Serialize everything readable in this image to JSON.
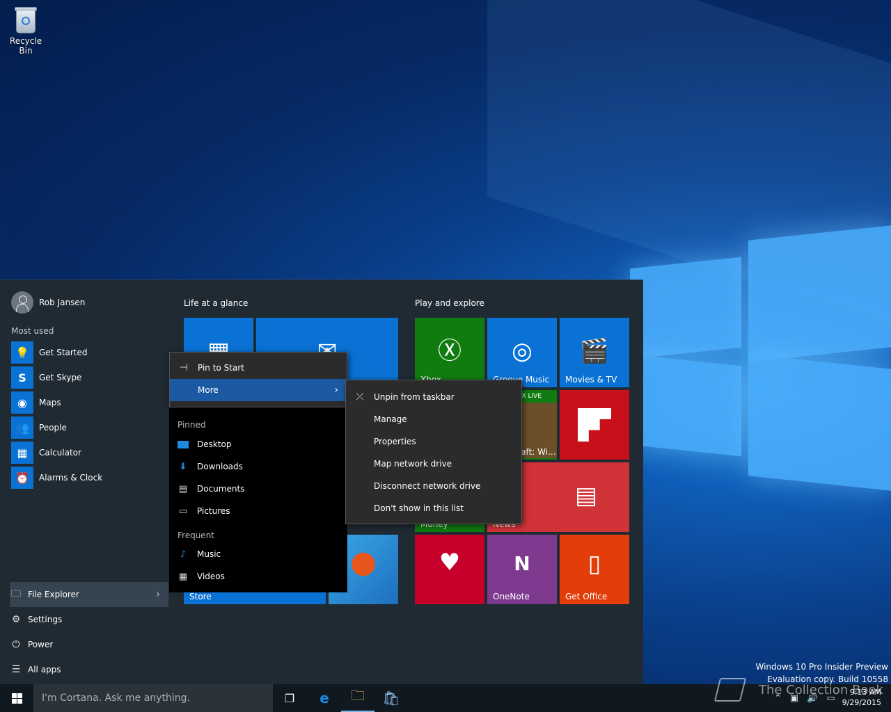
{
  "desktop": {
    "recycle_bin_label": "Recycle Bin",
    "watermark_line1": "Windows 10 Pro Insider Preview",
    "watermark_line2": "Evaluation copy. Build 10558",
    "brand_text": "The Collection Book"
  },
  "start": {
    "user_name": "Rob Jansen",
    "most_used_header": "Most used",
    "most_used": [
      {
        "label": "Get Started",
        "icon": "lightbulb-icon"
      },
      {
        "label": "Get Skype",
        "icon": "skype-icon"
      },
      {
        "label": "Maps",
        "icon": "maps-icon"
      },
      {
        "label": "People",
        "icon": "people-icon"
      },
      {
        "label": "Calculator",
        "icon": "calculator-icon"
      },
      {
        "label": "Alarms & Clock",
        "icon": "alarm-clock-icon"
      }
    ],
    "bottom": {
      "file_explorer": "File Explorer",
      "settings": "Settings",
      "power": "Power",
      "all_apps": "All apps"
    },
    "groups": {
      "life": "Life at a glance",
      "play": "Play and explore"
    },
    "tiles": {
      "xbox": "Xbox",
      "groove": "Groove Music",
      "movies": "Movies & TV",
      "xbox_live_badge": "XBOX LIVE",
      "minecraft": "Minecraft: Wi...",
      "money": "Money",
      "news": "News",
      "onenote": "OneNote",
      "get_office": "Get Office",
      "store": "Store"
    },
    "colors": {
      "accent": "#0a72d4",
      "xbox": "#107c10",
      "flipboard": "#c8101a",
      "news": "#d13438",
      "iheart": "#c6002b",
      "onenote": "#7d3a8f",
      "office": "#e33e0a"
    }
  },
  "context_menu": {
    "pin_to_start": "Pin to Start",
    "more": "More"
  },
  "jump_list": {
    "pinned_header": "Pinned",
    "pinned": [
      "Desktop",
      "Downloads",
      "Documents",
      "Pictures"
    ],
    "frequent_header": "Frequent",
    "frequent": [
      "Music",
      "Videos"
    ]
  },
  "submenu": {
    "items": [
      "Unpin from taskbar",
      "Manage",
      "Properties",
      "Map network drive",
      "Disconnect network drive",
      "Don't show in this list"
    ]
  },
  "taskbar": {
    "search_placeholder": "I'm Cortana. Ask me anything.",
    "time": "9:13 AM",
    "date": "9/29/2015"
  }
}
